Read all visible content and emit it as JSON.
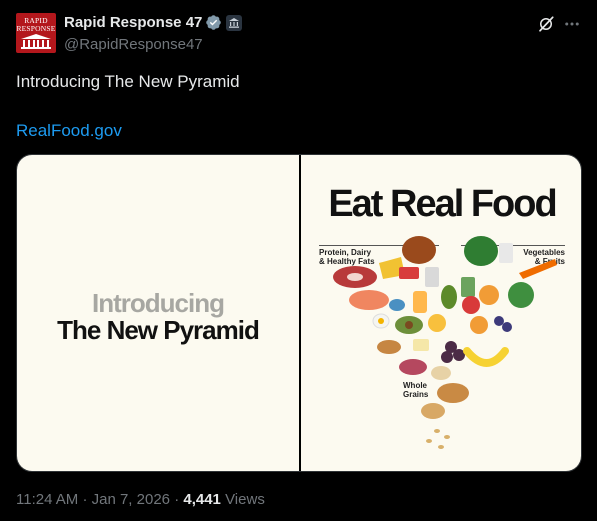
{
  "author": {
    "avatar_text": [
      "RAPID",
      "RESPONSE"
    ],
    "name": "Rapid Response 47",
    "handle": "@RapidResponse47",
    "verified_icon": "verified-badge-icon",
    "affiliate_icon": "government-building-icon"
  },
  "actions": {
    "grok_icon": "grok-icon",
    "more_icon": "more-options-icon"
  },
  "tweet": {
    "text": "Introducing The New Pyramid",
    "link": "RealFood.gov"
  },
  "media": {
    "left": {
      "line1": "Introducing",
      "line2": "The New Pyramid"
    },
    "right": {
      "title": "Eat Real Food",
      "label_left": [
        "Protein, Dairy",
        "& Healthy Fats"
      ],
      "label_right": [
        "Vegetables",
        "& Fruits"
      ],
      "label_bottom": [
        "Whole",
        "Grains"
      ]
    }
  },
  "meta": {
    "time": "11:24 AM",
    "separator": "·",
    "date": "Jan 7, 2026",
    "views_count": "4,441",
    "views_label": "Views"
  },
  "colors": {
    "background": "#000000",
    "text": "#e7e9ea",
    "muted": "#71767b",
    "link": "#1d9bf0",
    "verified": "#829aab",
    "avatar_red": "#b3171c",
    "panel_bg": "#fcfaf0"
  }
}
